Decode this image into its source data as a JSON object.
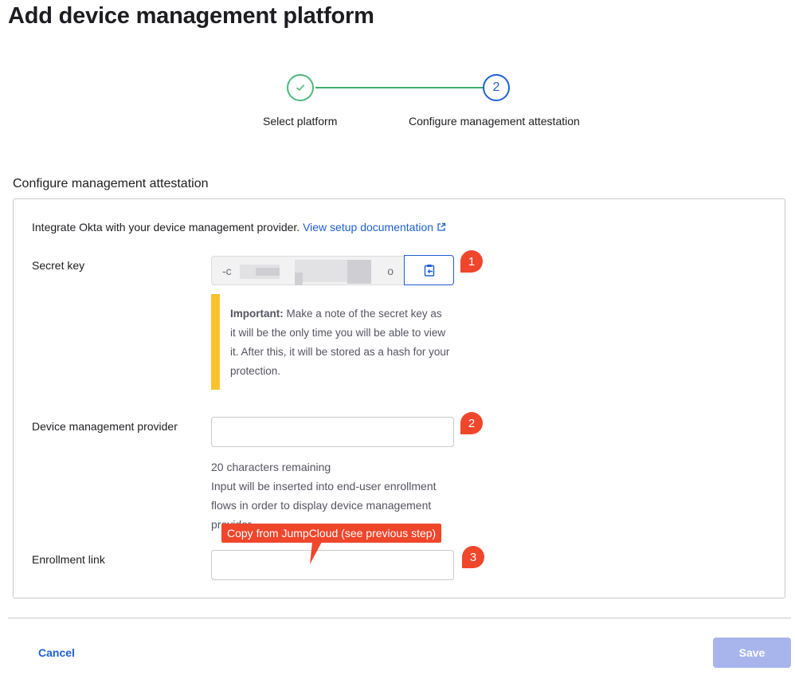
{
  "page": {
    "title": "Add device management platform"
  },
  "stepper": {
    "steps": [
      {
        "label": "Select platform",
        "status": "complete",
        "icon": "check-icon"
      },
      {
        "label": "Configure management attestation",
        "status": "current",
        "number": "2"
      }
    ],
    "colors": {
      "complete": "#4cb87a",
      "current": "#1f5fd6"
    }
  },
  "section": {
    "title": "Configure management attestation",
    "intro_text": "Integrate Okta with your device management provider.",
    "doc_link": "View setup documentation",
    "doc_link_icon": "external-link-icon"
  },
  "fields": {
    "secret_key": {
      "label": "Secret key",
      "value_start": "-c",
      "value_end": "o",
      "value_redacted": true,
      "copy_icon": "clipboard-copy-icon"
    },
    "callout": {
      "bold": "Important:",
      "text": " Make a note of the secret key as it will be the only time you will be able to view it. After this, it will be stored as a hash for your protection.",
      "accent_color": "#fbc22f"
    },
    "device_management_provider": {
      "label": "Device management provider",
      "value": "",
      "chars_remaining": "20 characters remaining",
      "help_text": "Input will be inserted into end-user enrollment flows in order to display device management provider"
    },
    "enrollment_link": {
      "label": "Enrollment link",
      "value": ""
    }
  },
  "annotations": {
    "badges": [
      "1",
      "2",
      "3"
    ],
    "tooltip": "Copy from JumpCloud (see previous step)",
    "color": "#f0462b"
  },
  "footer": {
    "cancel_label": "Cancel",
    "save_label": "Save",
    "save_disabled": true
  }
}
